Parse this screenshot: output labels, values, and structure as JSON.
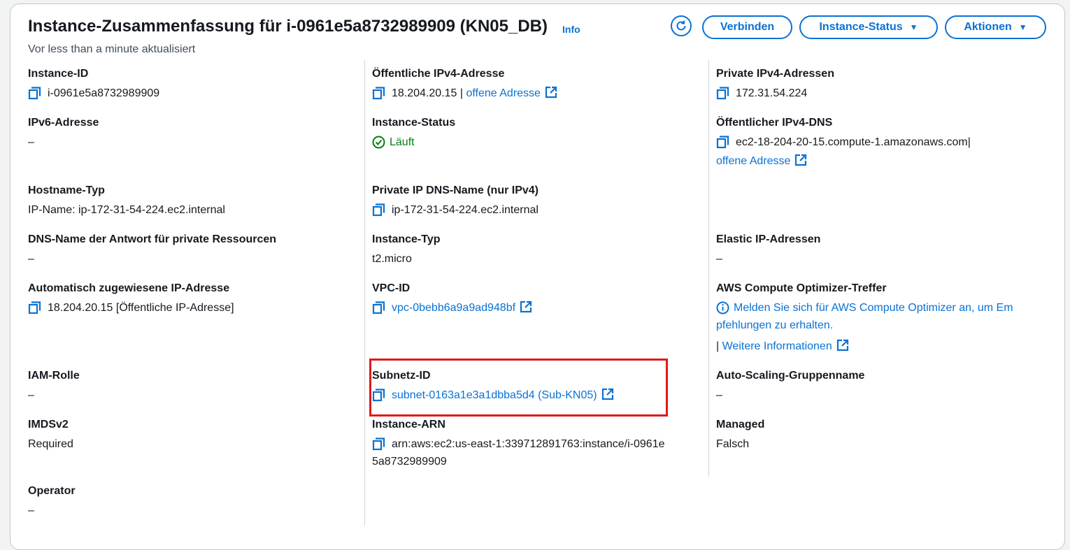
{
  "header": {
    "title": "Instance-Zusammenfassung für i-0961e5a8732989909 (KN05_DB)",
    "info": "Info",
    "updated": "Vor less than a minute aktualisiert",
    "buttons": {
      "connect": "Verbinden",
      "instance_state": "Instance-Status",
      "actions": "Aktionen"
    }
  },
  "fields": {
    "instance_id": {
      "label": "Instance-ID",
      "value": "i-0961e5a8732989909"
    },
    "public_ipv4": {
      "label": "Öffentliche IPv4-Adresse",
      "value": "18.204.20.15",
      "sep": "|",
      "link": "offene Adresse"
    },
    "private_ipv4": {
      "label": "Private IPv4-Adressen",
      "value": "172.31.54.224"
    },
    "ipv6": {
      "label": "IPv6-Adresse",
      "value": "–"
    },
    "instance_state": {
      "label": "Instance-Status",
      "value": "Läuft"
    },
    "public_dns": {
      "label": "Öffentlicher IPv4-DNS",
      "value": "ec2-18-204-20-15.compute-1.amazonaws.com",
      "sep": "|",
      "link": "offene Adresse"
    },
    "hostname_type": {
      "label": "Hostname-Typ",
      "value": "IP-Name: ip-172-31-54-224.ec2.internal"
    },
    "private_dns": {
      "label": "Private IP DNS-Name (nur IPv4)",
      "value": "ip-172-31-54-224.ec2.internal"
    },
    "answer_dns": {
      "label": "DNS-Name der Antwort für private Ressourcen",
      "value": "–"
    },
    "instance_type": {
      "label": "Instance-Typ",
      "value": "t2.micro"
    },
    "elastic_ip": {
      "label": "Elastic IP-Adressen",
      "value": "–"
    },
    "auto_ip": {
      "label": "Automatisch zugewiesene IP-Adresse",
      "value": "18.204.20.15 [Öffentliche IP-Adresse]"
    },
    "vpc_id": {
      "label": "VPC-ID",
      "value": "vpc-0bebb6a9a9ad948bf"
    },
    "optimizer": {
      "label": "AWS Compute Optimizer-Treffer",
      "line1": "Melden Sie sich für AWS Compute Optimizer an, um Em",
      "line2": "pfehlungen zu erhalten.",
      "sep": "|",
      "more": "Weitere Informationen"
    },
    "iam_role": {
      "label": "IAM-Rolle",
      "value": "–"
    },
    "subnet_id": {
      "label": "Subnetz-ID",
      "value": "subnet-0163a1e3a1dbba5d4 (Sub-KN05)"
    },
    "asg_name": {
      "label": "Auto-Scaling-Gruppenname",
      "value": "–"
    },
    "imdsv2": {
      "label": "IMDSv2",
      "value": "Required"
    },
    "instance_arn": {
      "label": "Instance-ARN",
      "line1": "arn:aws:ec2:us-east-1:339712891763:instance/i-0961e",
      "line2": "5a8732989909"
    },
    "managed": {
      "label": "Managed",
      "value": "Falsch"
    },
    "operator": {
      "label": "Operator",
      "value": "–"
    }
  },
  "colors": {
    "link": "#0972d3",
    "ok": "#037f0c",
    "highlight": "#e0191a"
  },
  "icons": [
    "refresh-icon",
    "copy-icon",
    "external-link-icon",
    "check-circle-icon",
    "info-circle-icon",
    "caret-down-icon"
  ]
}
